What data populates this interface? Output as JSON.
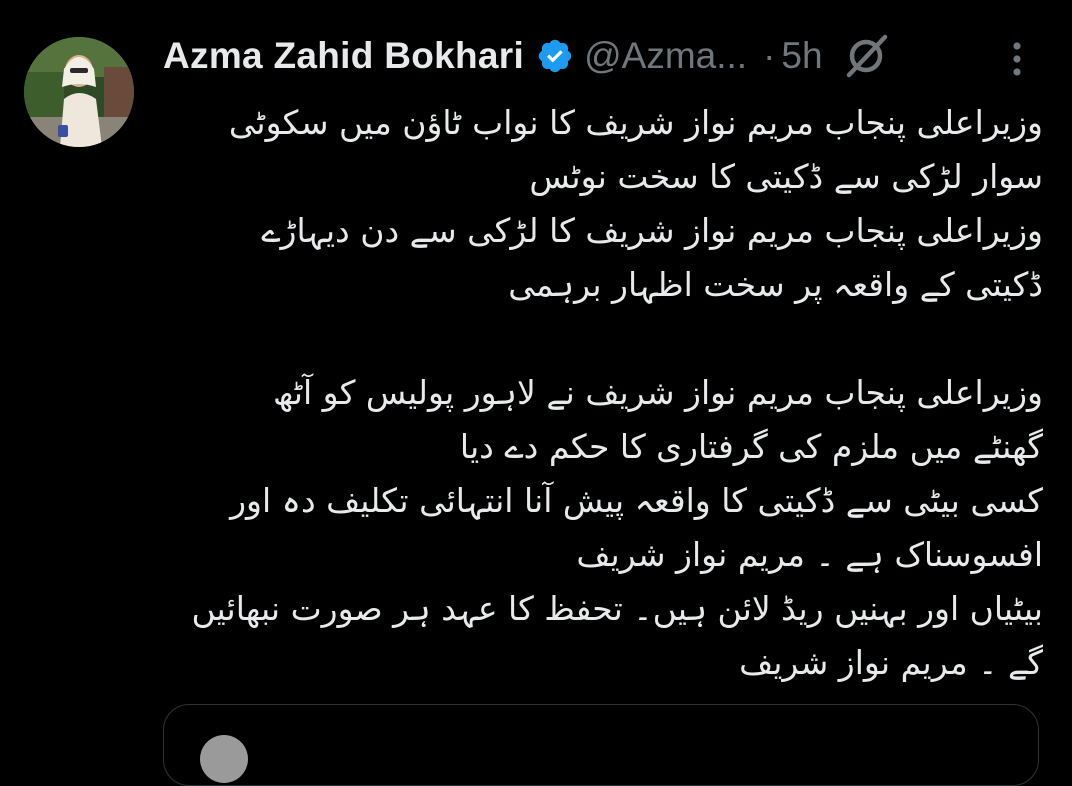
{
  "author": {
    "name": "Azma Zahid Bokhari",
    "handle": "@Azma...",
    "separator": "·",
    "time": "5h"
  },
  "icons": {
    "avatar": "avatar",
    "verified": "verified-badge-icon",
    "grok": "grok-icon",
    "more": "more-vertical-icon"
  },
  "colors": {
    "background": "#000000",
    "text": "#e7e9ea",
    "muted": "#71767b",
    "verified": "#1d9bf0",
    "border": "#2f3336"
  },
  "tweet": {
    "lines": [
      "وزیراعلی پنجاب مریم نواز شریف کا نواب ٹاؤن میں سکوٹی",
      "سوار لڑکی سے ڈکیتی کا  سخت نوٹس",
      "وزیراعلی پنجاب مریم نواز شریف کا لڑکی سے دن دیہاڑے",
      "ڈکیتی کے واقعہ پر سخت اظہار برہمی",
      "",
      "وزیراعلی پنجاب مریم نواز شریف نے لاہور پولیس کو آٹھ",
      "گھنٹے میں ملزم کی گرفتاری کا حکم دے دیا",
      "کسی بیٹی سے ڈکیتی کا واقعہ پیش آنا انتہائی تکلیف دہ اور",
      "افسوسناک ہے ۔ مریم نواز شریف",
      "بیٹیاں اور بہنیں  ریڈ لائن ہیں۔ تحفظ کا عہد ہر صورت نبھائیں",
      "گے ۔ مریم نواز شریف"
    ]
  }
}
